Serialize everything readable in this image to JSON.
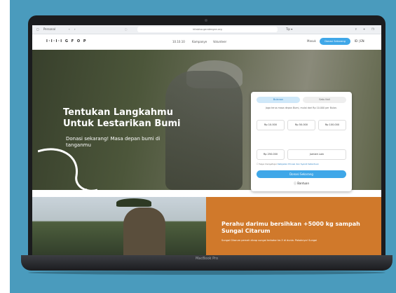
{
  "browser": {
    "profile": "Personal",
    "url": "kitabisa.gandengan.org",
    "tab_label": "Tip ▾"
  },
  "header": {
    "logo": "I·I·I·I G F O P",
    "nav": [
      "10.10.10",
      "Kampanye",
      "Volunteer"
    ],
    "login": "Masuk",
    "donate": "Donasi Sekarang",
    "lang": "ID | EN"
  },
  "hero": {
    "title": "Tentukan Langkahmu Untuk Lestarikan Bumi",
    "subtitle": "Donasi sekarang! Masa depan bumi di tanganmu"
  },
  "donation_card": {
    "tabs": [
      "Bulanan",
      "Satu Kali"
    ],
    "description": "Jaga terus masa depan Bumi, mulai dari Rp 10.000 per Bulan.",
    "amounts": [
      "Rp 10.000",
      "Rp 50.000",
      "Rp 100.000",
      "Rp 250.000",
      "Jumlah Lain"
    ],
    "policy_prefix": "Saya menyetujui",
    "policy_link": "Kebijakan Privasi dan Syarat Ketentuan",
    "submit": "Donasi Sekarang",
    "share": "Bantuan"
  },
  "lower": {
    "title": "Perahu darimu bersihkan +5000 kg sampah Sungai Citarum",
    "text": "Sungai Citarum pernah dicap sungai terkotor ke-3 di dunia. Pokoknya! Sungai"
  },
  "device": {
    "label": "MacBook Pro"
  },
  "colors": {
    "primary_blue": "#3fa7e8",
    "orange": "#d0792b",
    "background_teal": "#4a9bbd"
  }
}
